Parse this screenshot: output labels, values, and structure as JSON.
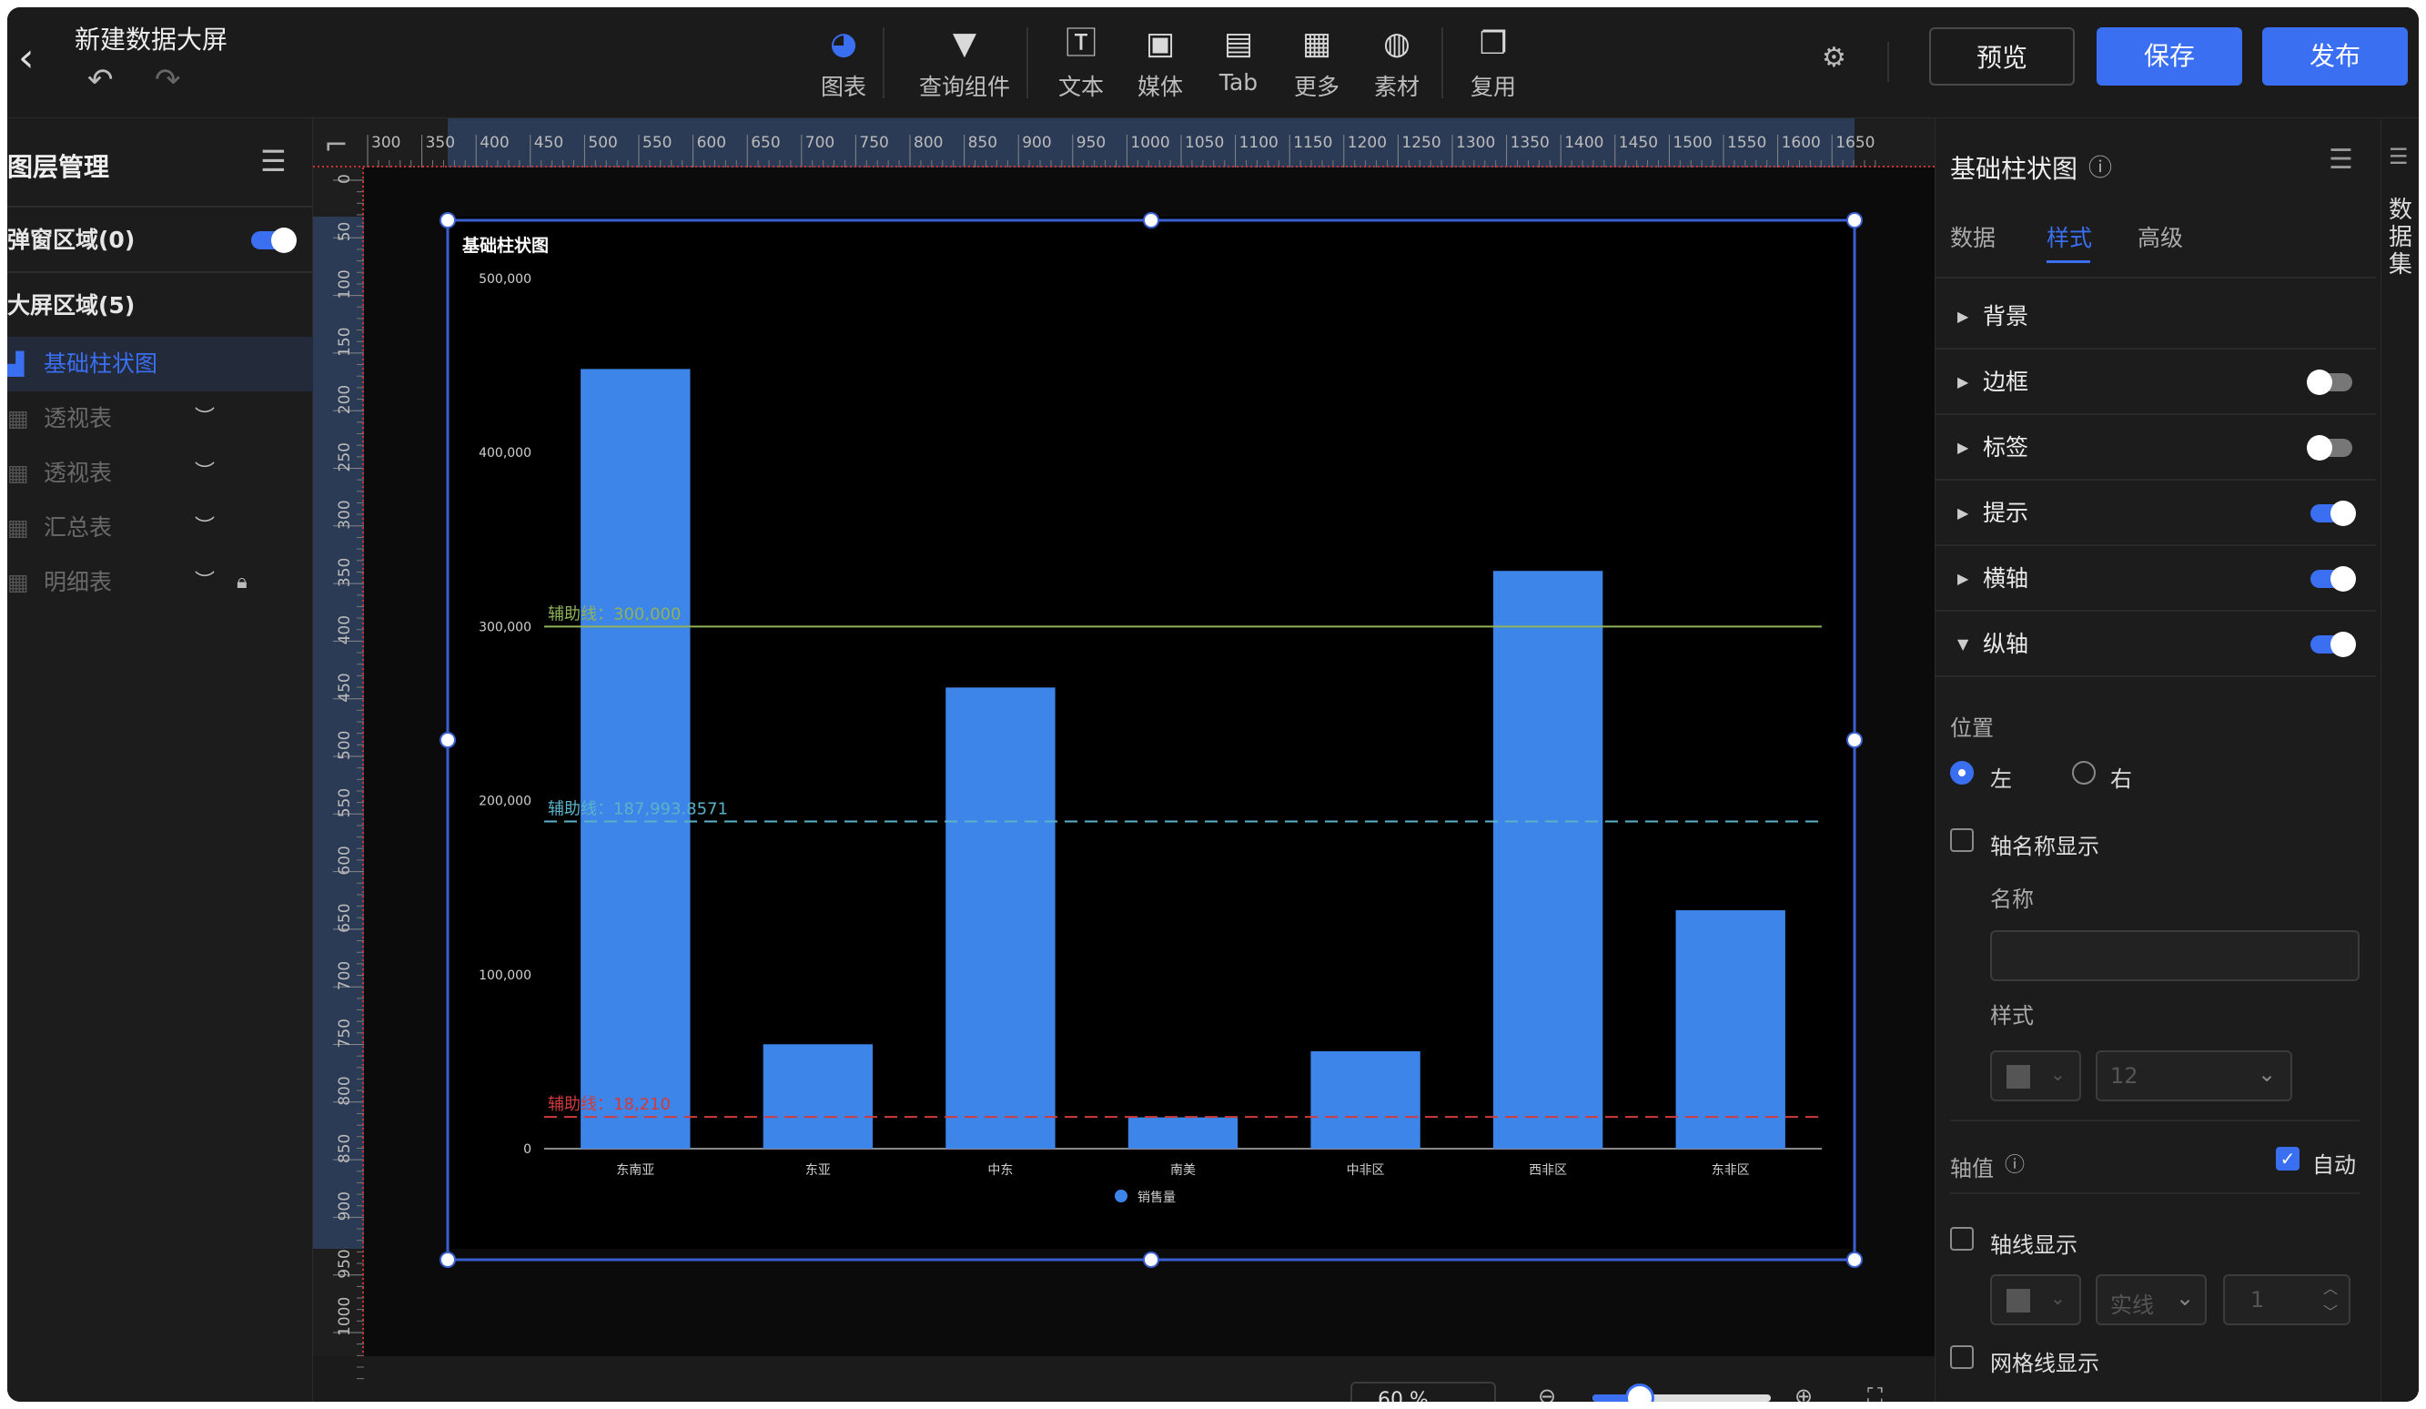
{
  "header": {
    "title": "新建数据大屏",
    "undo_icon": "undo-icon",
    "redo_icon": "redo-icon",
    "toolbar": [
      {
        "label": "图表",
        "icon": "chart-pie-icon"
      },
      {
        "label": "查询组件",
        "icon": "filter-icon"
      },
      {
        "label": "文本",
        "icon": "text-icon"
      },
      {
        "label": "媒体",
        "icon": "image-icon"
      },
      {
        "label": "Tab",
        "icon": "tab-icon"
      },
      {
        "label": "更多",
        "icon": "grid-icon"
      },
      {
        "label": "素材",
        "icon": "palette-icon"
      },
      {
        "label": "复用",
        "icon": "copy-icon"
      }
    ],
    "preview_label": "预览",
    "save_label": "保存",
    "publish_label": "发布"
  },
  "layers": {
    "title": "图层管理",
    "popup_area": "弹窗区域(0)",
    "popup_toggle_on": true,
    "screen_area": "大屏区域(5)",
    "items": [
      {
        "label": "基础柱状图",
        "active": true
      },
      {
        "label": "透视表",
        "hidden": true
      },
      {
        "label": "透视表",
        "hidden": true
      },
      {
        "label": "汇总表",
        "hidden": true
      },
      {
        "label": "明细表",
        "hidden": true,
        "locked": true
      }
    ]
  },
  "canvas": {
    "h_ruler": [
      "300",
      "350",
      "400",
      "450",
      "500",
      "550",
      "600",
      "650",
      "700",
      "750",
      "800",
      "850",
      "900",
      "950",
      "1000",
      "1050",
      "1100",
      "1150",
      "1200",
      "1250",
      "1300",
      "1350",
      "1400",
      "1450",
      "1500",
      "1550",
      "1600",
      "1650"
    ],
    "v_ruler": [
      "0",
      "50",
      "100",
      "150",
      "200",
      "250",
      "300",
      "350",
      "400",
      "450",
      "500",
      "550",
      "600",
      "650",
      "700",
      "750",
      "800",
      "850",
      "900",
      "950",
      "1000"
    ],
    "zoom": "60 %"
  },
  "chart_data": {
    "type": "bar",
    "title": "基础柱状图",
    "categories": [
      "东南亚",
      "东亚",
      "中东",
      "南美",
      "中非区",
      "西非区",
      "东非区"
    ],
    "series": [
      {
        "name": "销售量",
        "values": [
          448000,
          60000,
          265000,
          18000,
          56000,
          332000,
          137000
        ],
        "color": "#3d85e8"
      }
    ],
    "ylim": [
      0,
      500000
    ],
    "yticks": [
      "0",
      "100,000",
      "200,000",
      "300,000",
      "400,000",
      "500,000"
    ],
    "reference_lines": [
      {
        "label": "辅助线：300,000",
        "value": 300000,
        "color": "#8fb35a",
        "style": "solid"
      },
      {
        "label": "辅助线：187,993.8571",
        "value": 187993.8571,
        "color": "#5ab3c8",
        "style": "dashed"
      },
      {
        "label": "辅助线：18,210",
        "value": 18210,
        "color": "#d23b3b",
        "style": "dashed"
      }
    ],
    "legend_position": "bottom",
    "grid": false
  },
  "props": {
    "title": "基础柱状图",
    "tabs": [
      "数据",
      "样式",
      "高级"
    ],
    "active_tab": "样式",
    "sections": [
      {
        "label": "背景",
        "toggle": null,
        "expanded": false
      },
      {
        "label": "边框",
        "toggle": false,
        "expanded": false
      },
      {
        "label": "标签",
        "toggle": false,
        "expanded": false
      },
      {
        "label": "提示",
        "toggle": true,
        "expanded": false
      },
      {
        "label": "横轴",
        "toggle": true,
        "expanded": false
      },
      {
        "label": "纵轴",
        "toggle": true,
        "expanded": true
      }
    ],
    "position_label": "位置",
    "position_left": "左",
    "position_right": "右",
    "axis_name_show": "轴名称显示",
    "name_label": "名称",
    "style_label": "样式",
    "font_size": "12",
    "axis_value": "轴值",
    "auto_label": "自动",
    "axis_line_show": "轴线显示",
    "line_style": "实线",
    "line_width": "1",
    "grid_line_show": "网格线显示"
  },
  "rail": {
    "label": "数据集"
  },
  "colors": {
    "accent": "#3a6ff2",
    "bar": "#3d85e8"
  }
}
